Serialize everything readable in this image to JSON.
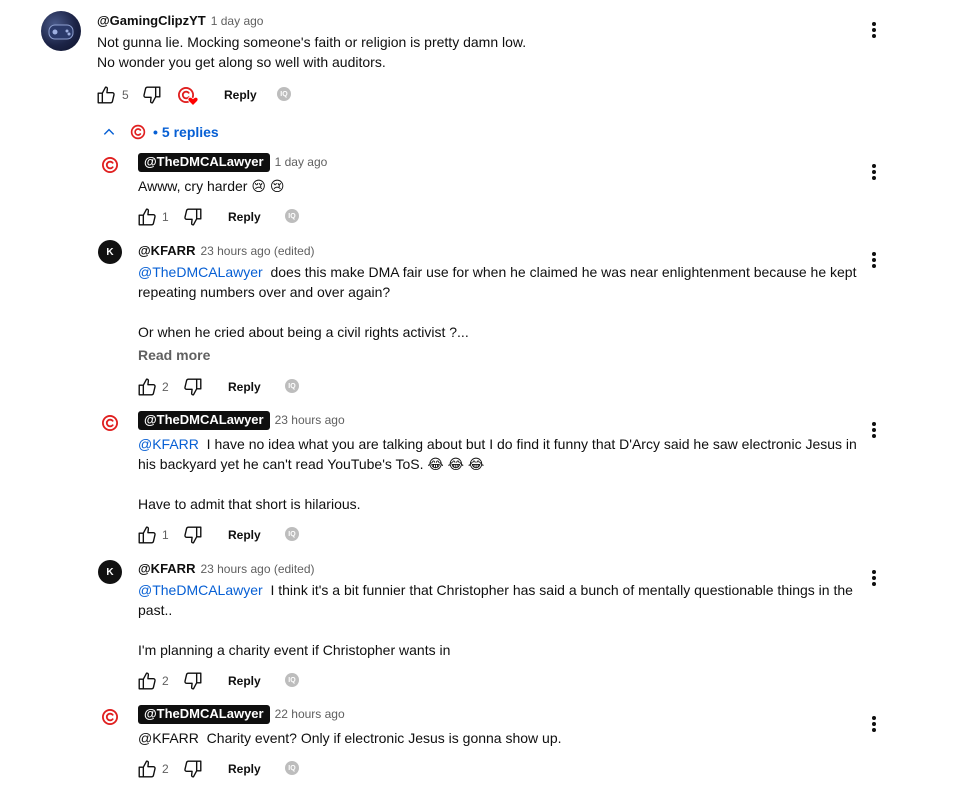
{
  "top_comment": {
    "author": "@GamingClipzYT",
    "time": "1 day ago",
    "lines": [
      "Not gunna lie. Mocking someone's faith or religion is pretty damn low.",
      "No wonder you get along so well with auditors."
    ],
    "likes": "5",
    "reply_label": "Reply"
  },
  "replies_toggle": {
    "dot": "•",
    "label": "5 replies"
  },
  "replies": [
    {
      "author": "@TheDMCALawyer",
      "time": "1 day ago",
      "text": "Awww, cry harder 😢 😢",
      "likes": "1",
      "reply_label": "Reply"
    },
    {
      "author": "@KFARR",
      "time": "23 hours ago (edited)",
      "mention": "@TheDMCALawyer",
      "text1": "does this make DMA fair use for when he claimed he was near enlightenment because he kept",
      "text2": "repeating numbers over and over again?",
      "text3": "Or when he cried about being a civil rights activist ?...",
      "read_more": "Read more",
      "likes": "2",
      "reply_label": "Reply"
    },
    {
      "author": "@TheDMCALawyer",
      "time": "23 hours ago",
      "mention": "@KFARR",
      "text1": "I have no idea what you are talking about but I do find it funny that D'Arcy said he saw electronic Jesus in",
      "text2": "his backyard yet he can't read YouTube's ToS. 😂 😂 😂",
      "text3": "Have to admit that short is hilarious.",
      "likes": "1",
      "reply_label": "Reply"
    },
    {
      "author": "@KFARR",
      "time": "23 hours ago (edited)",
      "mention": "@TheDMCALawyer",
      "text1": "I think it's a bit funnier that Christopher has said a bunch of mentally questionable things in the",
      "text2": "past..",
      "text3": "I'm planning a charity event if Christopher wants in",
      "likes": "2",
      "reply_label": "Reply"
    },
    {
      "author": "@TheDMCALawyer",
      "time": "22 hours ago",
      "text": "@KFARR  Charity event? Only if electronic Jesus is gonna show up.",
      "likes": "2",
      "reply_label": "Reply"
    }
  ],
  "colors": {
    "accent": "#065fd4",
    "creator_red": "#e02020",
    "text": "#0f0f0f",
    "muted": "#606060"
  }
}
